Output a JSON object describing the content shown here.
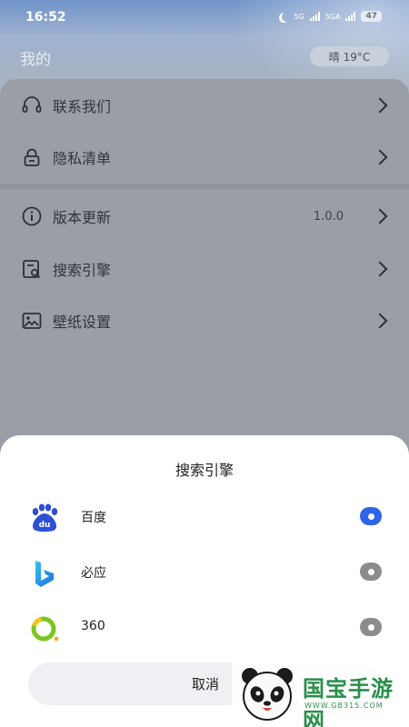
{
  "status_bar": {
    "time": "16:52",
    "network_1": "5G",
    "network_2": "5GA",
    "battery": "47"
  },
  "header": {
    "title": "我的",
    "weather": "晴 19°C"
  },
  "menu": {
    "items": [
      {
        "label": "联系我们",
        "icon": "headset-icon",
        "value": ""
      },
      {
        "label": "隐私清单",
        "icon": "lock-icon",
        "value": ""
      },
      {
        "label": "版本更新",
        "icon": "info-icon",
        "value": "1.0.0"
      },
      {
        "label": "搜索引擎",
        "icon": "search-engine-icon",
        "value": ""
      },
      {
        "label": "壁纸设置",
        "icon": "wallpaper-icon",
        "value": ""
      }
    ]
  },
  "sheet": {
    "title": "搜索引擎",
    "options": [
      {
        "label": "百度",
        "icon": "baidu-logo-icon",
        "selected": true,
        "logo_text": "du"
      },
      {
        "label": "必应",
        "icon": "bing-logo-icon",
        "selected": false
      },
      {
        "label": "360",
        "icon": "360-logo-icon",
        "selected": false
      }
    ],
    "cancel_label": "取消"
  },
  "watermark": {
    "text": "国宝手游网",
    "url": "WWW.GB315.COM"
  },
  "colors": {
    "accent": "#2f64e8",
    "radio_off": "#8c8c8c",
    "watermark": "#2a8f4a"
  }
}
